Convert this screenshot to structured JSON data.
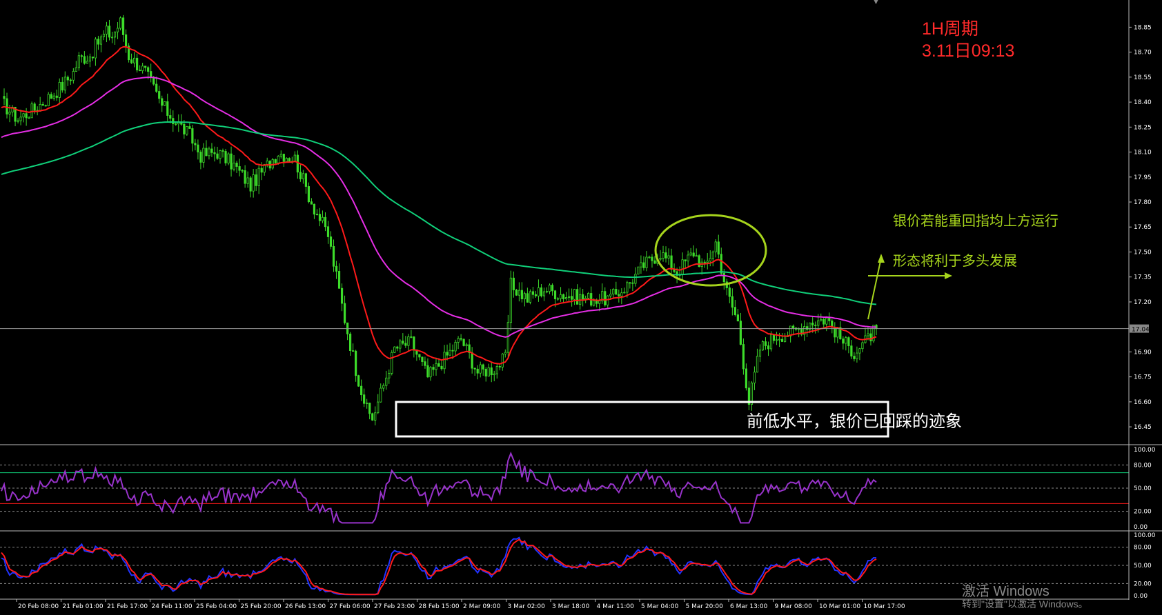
{
  "annotations": {
    "timeframe": "1H周期",
    "datetime": "3.11日09:13",
    "bullish_line1": "银价若能重回指均上方运行",
    "bullish_line2": "形态将利于多头发展",
    "support_note": "前低水平，银价已回踩的迹象"
  },
  "watermark": {
    "title": "激活 Windows",
    "subtitle": "转到\"设置\"以激活 Windows。"
  },
  "colors": {
    "background": "#000000",
    "candle": "#3ddc2a",
    "ma_fast": "#ff1a1a",
    "ma_mid": "#e62ee6",
    "ma_slow": "#10d07a",
    "rsi": "#9933cc",
    "stoch_main": "#2233ff",
    "stoch_signal": "#ff1a1a",
    "axis_text": "#ffffff",
    "grid_dash": "#8a8a8a"
  },
  "chart_data": [
    {
      "type": "candlestick",
      "symbol_timeframe": "H1",
      "price_axis_ticks": [
        18.85,
        18.7,
        18.55,
        18.4,
        18.25,
        18.1,
        17.95,
        17.8,
        17.65,
        17.5,
        17.35,
        17.2,
        17.04,
        16.9,
        16.75,
        16.6,
        16.45
      ],
      "current_price": 17.04,
      "current_price_label": "17.04",
      "ylim": [
        16.38,
        18.98
      ],
      "x_tick_labels": [
        "20 Feb 08:00",
        "21 Feb 01:00",
        "21 Feb 17:00",
        "24 Feb 11:00",
        "25 Feb 04:00",
        "25 Feb 20:00",
        "26 Feb 13:00",
        "27 Feb 06:00",
        "27 Feb 23:00",
        "28 Feb 15:00",
        "2 Mar 09:00",
        "3 Mar 02:00",
        "3 Mar 18:00",
        "4 Mar 11:00",
        "5 Mar 04:00",
        "5 Mar 20:00",
        "6 Mar 13:00",
        "9 Mar 08:00",
        "10 Mar 01:00",
        "10 Mar 17:00"
      ],
      "close_path": [
        [
          0,
          18.4
        ],
        [
          6,
          18.3
        ],
        [
          12,
          18.36
        ],
        [
          18,
          18.44
        ],
        [
          22,
          18.5
        ],
        [
          26,
          18.58
        ],
        [
          28,
          18.66
        ],
        [
          32,
          18.68
        ],
        [
          35,
          18.76
        ],
        [
          38,
          18.82
        ],
        [
          40,
          18.8
        ],
        [
          43,
          18.88
        ],
        [
          46,
          18.68
        ],
        [
          52,
          18.58
        ],
        [
          58,
          18.38
        ],
        [
          62,
          18.3
        ],
        [
          68,
          18.2
        ],
        [
          72,
          18.08
        ],
        [
          78,
          18.1
        ],
        [
          84,
          18.02
        ],
        [
          90,
          17.9
        ],
        [
          96,
          18.02
        ],
        [
          100,
          18.1
        ],
        [
          106,
          18.06
        ],
        [
          112,
          17.8
        ],
        [
          118,
          17.6
        ],
        [
          124,
          17.1
        ],
        [
          128,
          16.8
        ],
        [
          132,
          16.55
        ],
        [
          134,
          16.5
        ],
        [
          138,
          16.7
        ],
        [
          142,
          16.92
        ],
        [
          148,
          16.96
        ],
        [
          154,
          16.75
        ],
        [
          160,
          16.86
        ],
        [
          166,
          16.98
        ],
        [
          172,
          16.78
        ],
        [
          178,
          16.8
        ],
        [
          182,
          16.86
        ],
        [
          184,
          17.3
        ],
        [
          190,
          17.22
        ],
        [
          196,
          17.28
        ],
        [
          204,
          17.24
        ],
        [
          212,
          17.22
        ],
        [
          220,
          17.22
        ],
        [
          226,
          17.3
        ],
        [
          232,
          17.42
        ],
        [
          238,
          17.5
        ],
        [
          244,
          17.38
        ],
        [
          250,
          17.5
        ],
        [
          254,
          17.4
        ],
        [
          258,
          17.56
        ],
        [
          262,
          17.26
        ],
        [
          266,
          17.08
        ],
        [
          270,
          16.6
        ],
        [
          274,
          16.92
        ],
        [
          280,
          17.0
        ],
        [
          286,
          17.02
        ],
        [
          292,
          17.08
        ],
        [
          298,
          17.1
        ],
        [
          304,
          16.96
        ],
        [
          308,
          16.9
        ],
        [
          312,
          16.96
        ],
        [
          316,
          17.04
        ]
      ],
      "moving_averages": [
        {
          "color_key": "ma_fast",
          "last_value": 16.98
        },
        {
          "color_key": "ma_mid",
          "last_value": 17.1
        },
        {
          "color_key": "ma_slow",
          "last_value": 17.35
        }
      ],
      "highlight_ellipse_label": "",
      "support_box_label": "前低水平，银价已回踩的迹象"
    },
    {
      "type": "line",
      "indicator": "RSI",
      "y_ticks": [
        "100.00",
        "80.00",
        "50.00",
        "20.00",
        "0.00"
      ],
      "ylim": [
        0,
        100
      ],
      "levels": [
        70,
        30
      ],
      "last_value": 60
    },
    {
      "type": "line",
      "indicator": "Stochastic",
      "y_ticks": [
        "100.00",
        "80.00",
        "50.00",
        "20.00",
        "0.00"
      ],
      "ylim": [
        0,
        100
      ],
      "last_value": 58
    }
  ]
}
